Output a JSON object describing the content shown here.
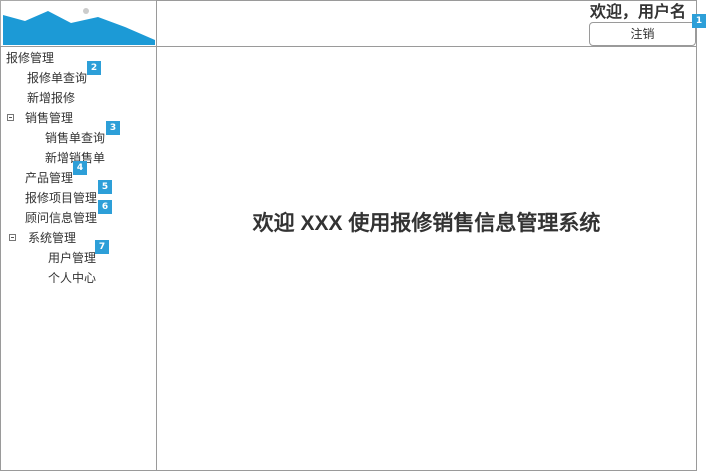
{
  "header": {
    "welcome_text": "欢迎，用户名",
    "logout_label": "注销"
  },
  "logo": {
    "icon": "image-placeholder-icon",
    "mountain_color": "#1c9ad6",
    "sun_color": "#cccccc"
  },
  "sidebar": {
    "repair": {
      "label": "报修管理",
      "items": [
        {
          "label": "报修单查询"
        },
        {
          "label": "新增报修"
        }
      ]
    },
    "sales": {
      "label": "销售管理",
      "items": [
        {
          "label": "销售单查询"
        },
        {
          "label": "新增销售单"
        }
      ]
    },
    "product": {
      "label": "产品管理"
    },
    "repair_project": {
      "label": "报修项目管理"
    },
    "consultant": {
      "label": "顾问信息管理"
    },
    "system": {
      "label": "系统管理",
      "items": [
        {
          "label": "用户管理"
        },
        {
          "label": "个人中心"
        }
      ]
    }
  },
  "main": {
    "title": "欢迎 XXX 使用报修销售信息管理系统"
  },
  "markers": [
    "1",
    "2",
    "3",
    "4",
    "5",
    "6",
    "7"
  ],
  "colors": {
    "marker": "#2d9fd8",
    "border": "#9a9a9a"
  }
}
